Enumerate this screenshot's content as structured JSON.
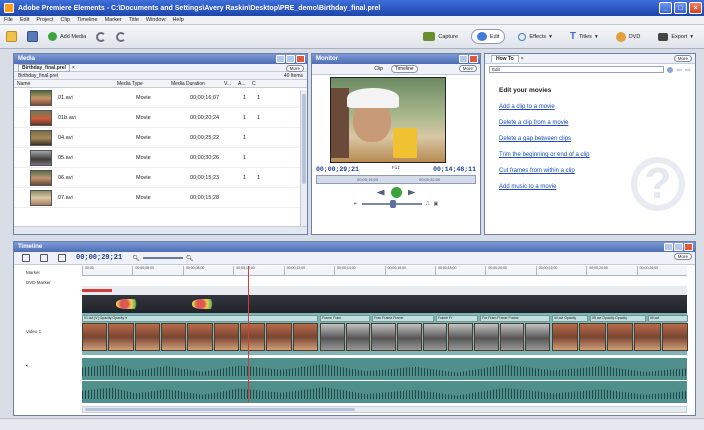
{
  "window": {
    "title": "Adobe Premiere Elements - C:\\Documents and Settings\\Avery Raskin\\Desktop\\PRE_demo\\Birthday_final.prel"
  },
  "menu": [
    "File",
    "Edit",
    "Project",
    "Clip",
    "Timeline",
    "Marker",
    "Title",
    "Window",
    "Help"
  ],
  "toolbar": {
    "add_media": "Add Media",
    "capture": "Capture",
    "edit": "Edit",
    "effects": "Effects",
    "titles": "Titles",
    "dvd": "DVD",
    "export": "Export"
  },
  "media_panel": {
    "title": "Media",
    "tab": "Birthday_final.prel",
    "tab_close": "×",
    "breadcrumb": "Birthday_final.prel",
    "more": "More",
    "items_count": "40 Items",
    "columns": [
      "Name",
      "Media Type",
      "Media Duration",
      "V...",
      "A...",
      "C"
    ],
    "rows": [
      {
        "name": "01.avi",
        "type": "Movie",
        "duration": "00;00;16;07",
        "v": "1",
        "a": "1"
      },
      {
        "name": "01b.avi",
        "type": "Movie",
        "duration": "00;00;20;24",
        "v": "1",
        "a": "1"
      },
      {
        "name": "04.avi",
        "type": "Movie",
        "duration": "00;00;25;22",
        "v": "1",
        "a": ""
      },
      {
        "name": "05.avi",
        "type": "Movie",
        "duration": "00;00;30;26",
        "v": "1",
        "a": ""
      },
      {
        "name": "06.avi",
        "type": "Movie",
        "duration": "00;00;15;23",
        "v": "1",
        "a": "1"
      },
      {
        "name": "07.avi",
        "type": "Movie",
        "duration": "00;00;15;28",
        "v": "",
        "a": ""
      }
    ]
  },
  "monitor": {
    "title": "Monitor",
    "clip_btn": "Clip",
    "timeline_btn": "Timeline",
    "more": "More",
    "current_tc": "00;00;29;21",
    "fit": "Fit",
    "total_tc": "00;14;48;11",
    "mini_a": "00;00;16;00",
    "mini_b": "00;00;32;00"
  },
  "howto": {
    "title": "How To",
    "tab": "How To",
    "tab_close": "×",
    "more": "More",
    "search_value": "Edit",
    "heading": "Edit your movies",
    "links": [
      "Add a clip to a movie",
      "Delete a clip from a movie",
      "Delete a gap between clips",
      "Trim the beginning or end of a clip",
      "Cut frames from within a clip",
      "Add music to a movie"
    ]
  },
  "timeline": {
    "title": "Timeline",
    "timecode": "00;00;29;21",
    "more": "More",
    "ruler": [
      "00;00",
      "00;00;06;00",
      "00;00;08;00",
      "00;00;10;00",
      "00;00;12;00",
      "00;00;14;00",
      "00;00;16;00",
      "00;00;18;00",
      "00;00;20;00",
      "00;00;22;00",
      "00;00;24;00",
      "00;00;26;00"
    ],
    "labels": {
      "marker": "Marker",
      "dvd": "DVD Marker",
      "video": "Video 1"
    },
    "clip_heads": [
      "01.avi [V] Opacity:Opacity ▾",
      "Frame Fram",
      "Fran Frame Frame",
      "Frame Fr",
      "Fra Fram Frame Frame",
      "04.avi Opacity",
      "05.avi Opacity:Opacity",
      "06.avi"
    ]
  }
}
